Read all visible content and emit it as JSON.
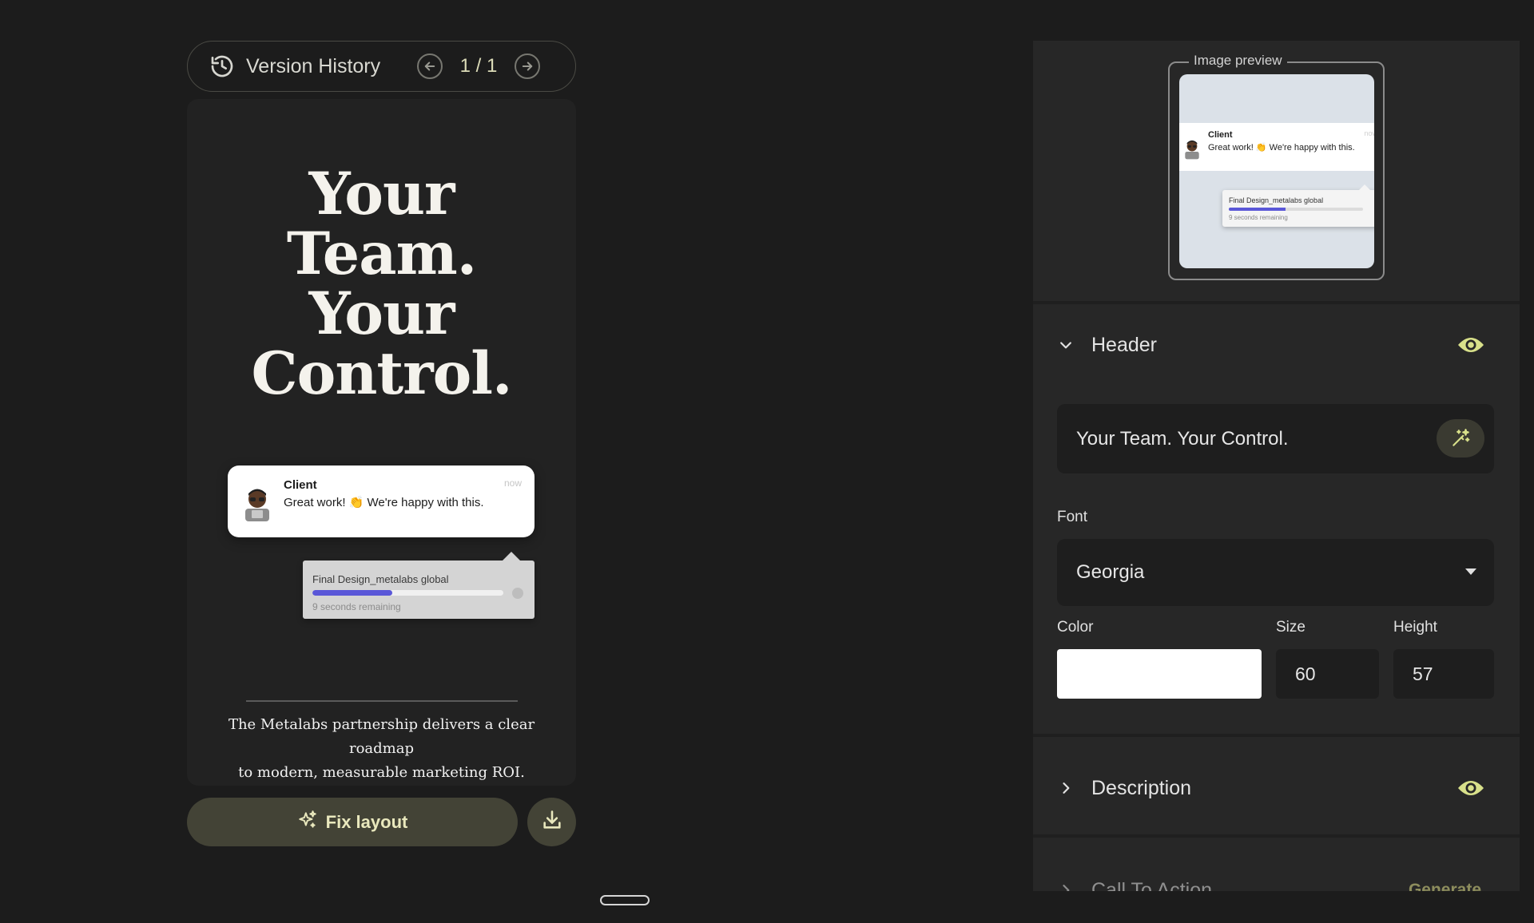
{
  "version_history": {
    "title": "Version History",
    "counter": "1 / 1"
  },
  "preview": {
    "headline_lines": [
      "Your",
      "Team.",
      "Your",
      "Control."
    ],
    "notification": {
      "title": "Client",
      "message": "Great work! 👏 We're happy with this.",
      "time": "now"
    },
    "upload": {
      "file_name": "Final Design_metalabs global",
      "remaining": "9 seconds remaining",
      "progress_fraction": 0.42
    },
    "description_lines": [
      "The Metalabs partnership delivers a clear roadmap",
      "to modern, measurable marketing ROI."
    ]
  },
  "actions": {
    "fix_layout": "Fix layout"
  },
  "panel": {
    "image_preview_label": "Image preview",
    "header_section": {
      "title": "Header",
      "text_value": "Your Team. Your Control.",
      "font_label": "Font",
      "font_value": "Georgia",
      "color_label": "Color",
      "color_value": "#ffffff",
      "size_label": "Size",
      "size_value": "60",
      "height_label": "Height",
      "height_value": "57"
    },
    "description_section": {
      "title": "Description"
    },
    "cta_section": {
      "title": "Call To Action",
      "generate_label": "Generate"
    }
  },
  "colors": {
    "accent": "#e9e8bd",
    "progress": "#5a57d8",
    "eye_icon": "#d8e08a"
  }
}
